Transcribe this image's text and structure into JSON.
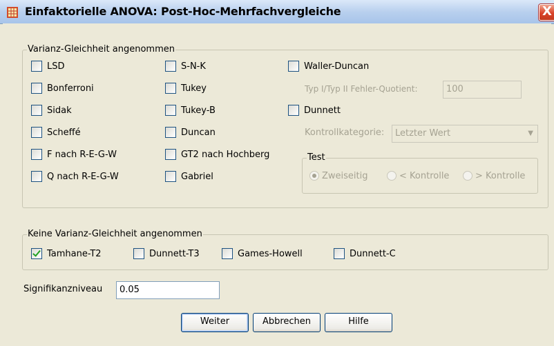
{
  "window": {
    "title": "Einfaktorielle ANOVA: Post-Hoc-Mehrfachvergleiche",
    "close_label": "X"
  },
  "equal_variance": {
    "legend": "Varianz-Gleichheit angenommen",
    "col1": [
      {
        "label": "LSD",
        "checked": false
      },
      {
        "label": "Bonferroni",
        "checked": false
      },
      {
        "label": "Sidak",
        "checked": false
      },
      {
        "label": "Scheffé",
        "checked": false
      },
      {
        "label": "F nach R-E-G-W",
        "checked": false
      },
      {
        "label": "Q nach R-E-G-W",
        "checked": false
      }
    ],
    "col2": [
      {
        "label": "S-N-K",
        "checked": false
      },
      {
        "label": "Tukey",
        "checked": false
      },
      {
        "label": "Tukey-B",
        "checked": false
      },
      {
        "label": "Duncan",
        "checked": false
      },
      {
        "label": "GT2 nach Hochberg",
        "checked": false
      },
      {
        "label": "Gabriel",
        "checked": false
      }
    ],
    "waller_duncan": {
      "label": "Waller-Duncan",
      "checked": false
    },
    "ratio_label": "Typ I/Typ II Fehler-Quotient:",
    "ratio_value": "100",
    "dunnett": {
      "label": "Dunnett",
      "checked": false
    },
    "control_category_label": "Kontrollkategorie:",
    "control_category_value": "Letzter Wert",
    "test": {
      "legend": "Test",
      "options": [
        {
          "label": "Zweiseitig",
          "selected": true
        },
        {
          "label": "< Kontrolle",
          "selected": false
        },
        {
          "label": "> Kontrolle",
          "selected": false
        }
      ]
    }
  },
  "unequal_variance": {
    "legend": "Keine Varianz-Gleichheit angenommen",
    "options": [
      {
        "label": "Tamhane-T2",
        "checked": true
      },
      {
        "label": "Dunnett-T3",
        "checked": false
      },
      {
        "label": "Games-Howell",
        "checked": false
      },
      {
        "label": "Dunnett-C",
        "checked": false
      }
    ]
  },
  "significance": {
    "label": "Signifikanzniveau",
    "value": "0.05"
  },
  "buttons": {
    "continue": "Weiter",
    "cancel": "Abbrechen",
    "help": "Hilfe"
  },
  "colors": {
    "dialog_bg": "#ece9d8",
    "titlebar": "#b9d0ee",
    "check_mark": "#21a121",
    "close_button": "#d9432a"
  }
}
